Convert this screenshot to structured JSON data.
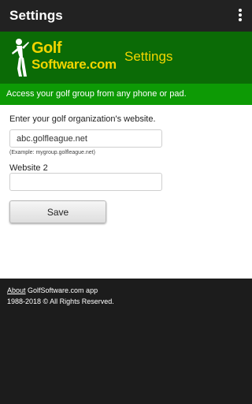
{
  "appbar": {
    "title": "Settings",
    "menu_icon": "more-vert-icon"
  },
  "brand": {
    "logo_golf": "Golf",
    "logo_software": "Software.com",
    "page_title": "Settings",
    "accent": "#f2d500",
    "background": "#0b6b06"
  },
  "tagline": "Access your golf group from any phone or pad.",
  "form": {
    "website_label": "Enter your golf organization's website.",
    "website_value": "abc.golfleague.net",
    "website_hint": "(Example: mygroup.golfleague.net)",
    "website2_label": "Website 2",
    "website2_value": "",
    "save_label": "Save"
  },
  "footer": {
    "about_link": "About",
    "about_text": " GolfSoftware.com app",
    "copyright": "1988-2018 © All Rights Reserved."
  }
}
